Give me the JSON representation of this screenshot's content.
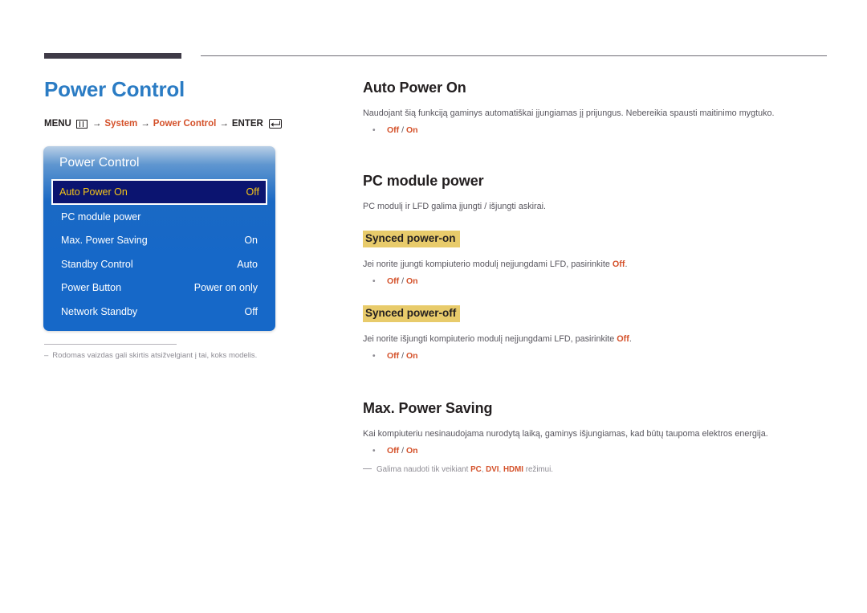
{
  "page": {
    "title": "Power Control",
    "breadcrumb": {
      "menu_label": "MENU",
      "menu_icon": "menu-grid-icon",
      "arrow": "→",
      "step1": "System",
      "step2": "Power Control",
      "enter_label": "ENTER",
      "enter_icon": "enter-key-icon"
    },
    "footnote": {
      "dash": "–",
      "text": "Rodomas vaizdas gali skirtis atsižvelgiant į tai, koks modelis."
    }
  },
  "osd": {
    "title": "Power Control",
    "rows": [
      {
        "label": "Auto Power On",
        "value": "Off",
        "selected": true
      },
      {
        "label": "PC module power",
        "value": "",
        "selected": false
      },
      {
        "label": "Max. Power Saving",
        "value": "On",
        "selected": false
      },
      {
        "label": "Standby Control",
        "value": "Auto",
        "selected": false
      },
      {
        "label": "Power Button",
        "value": "Power on only",
        "selected": false
      },
      {
        "label": "Network Standby",
        "value": "Off",
        "selected": false
      }
    ]
  },
  "sections": {
    "auto_power_on": {
      "heading": "Auto Power On",
      "body_pre": "Naudojant šią funkciją gaminys automatiškai įjungiamas jį prijungus. Nebereikia spausti maitinimo mygtuko.",
      "option_off": "Off",
      "option_sep": " / ",
      "option_on": "On"
    },
    "pc_module_power": {
      "heading": "PC module power",
      "body": "PC modulį ir LFD galima įjungti / išjungti askirai.",
      "synced_on": {
        "subheading": "Synced power-on",
        "body_pre": "Jei norite įjungti kompiuterio modulį neįjungdami LFD, pasirinkite ",
        "body_bold": "Off",
        "body_post": ".",
        "option_off": "Off",
        "option_sep": " / ",
        "option_on": "On"
      },
      "synced_off": {
        "subheading": "Synced power-off",
        "body_pre": "Jei norite išjungti kompiuterio modulį neįjungdami LFD, pasirinkite ",
        "body_bold": "Off",
        "body_post": ".",
        "option_off": "Off",
        "option_sep": " / ",
        "option_on": "On"
      }
    },
    "max_power_saving": {
      "heading": "Max. Power Saving",
      "body": "Kai kompiuteriu nesinaudojama nurodytą laiką, gaminys išjungiamas, kad būtų taupoma elektros energija.",
      "option_off": "Off",
      "option_sep": " / ",
      "option_on": "On",
      "footnote_pre": "Galima naudoti tik veikiant ",
      "footnote_pc": "PC",
      "footnote_c1": ", ",
      "footnote_dvi": "DVI",
      "footnote_c2": ", ",
      "footnote_hdmi": "HDMI",
      "footnote_post": " režimui."
    }
  },
  "colors": {
    "title_blue": "#2b7cc4",
    "accent_orange": "#d4512a",
    "osd_blue": "#1668c8",
    "osd_selected_navy": "#0b1470",
    "osd_selected_text": "#f5c518",
    "highlight_gold": "#e8cb6b",
    "muted_gray": "#8e8c94"
  }
}
